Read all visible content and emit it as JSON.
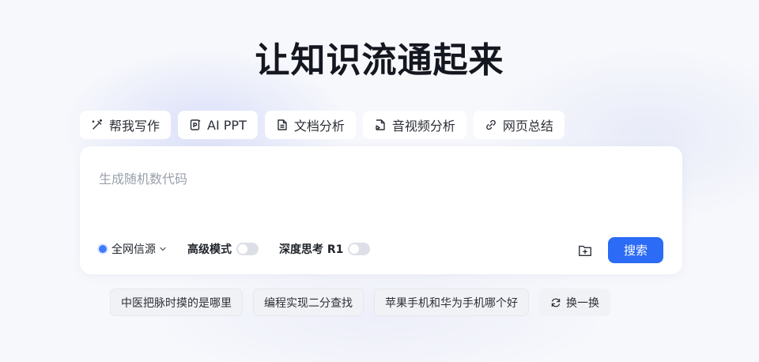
{
  "hero": {
    "title": "让知识流通起来"
  },
  "tools": [
    {
      "label": "帮我写作",
      "icon": "magic-pen-icon"
    },
    {
      "label": "AI PPT",
      "icon": "ppt-file-icon"
    },
    {
      "label": "文档分析",
      "icon": "document-icon"
    },
    {
      "label": "音视频分析",
      "icon": "media-file-icon"
    },
    {
      "label": "网页总结",
      "icon": "link-icon"
    }
  ],
  "search": {
    "placeholder": "生成随机数代码",
    "value": "",
    "source_label": "全网信源",
    "advanced_label": "高级模式",
    "deep_label": "深度思考 R1",
    "advanced_enabled": false,
    "deep_enabled": false,
    "button_label": "搜索"
  },
  "suggestions": [
    "中医把脉时摸的是哪里",
    "编程实现二分查找",
    "苹果手机和华为手机哪个好"
  ],
  "refresh_label": "换一换",
  "colors": {
    "accent": "#2b6bf5",
    "source_dot": "#3f7bff",
    "background": "#f7f8fc"
  }
}
